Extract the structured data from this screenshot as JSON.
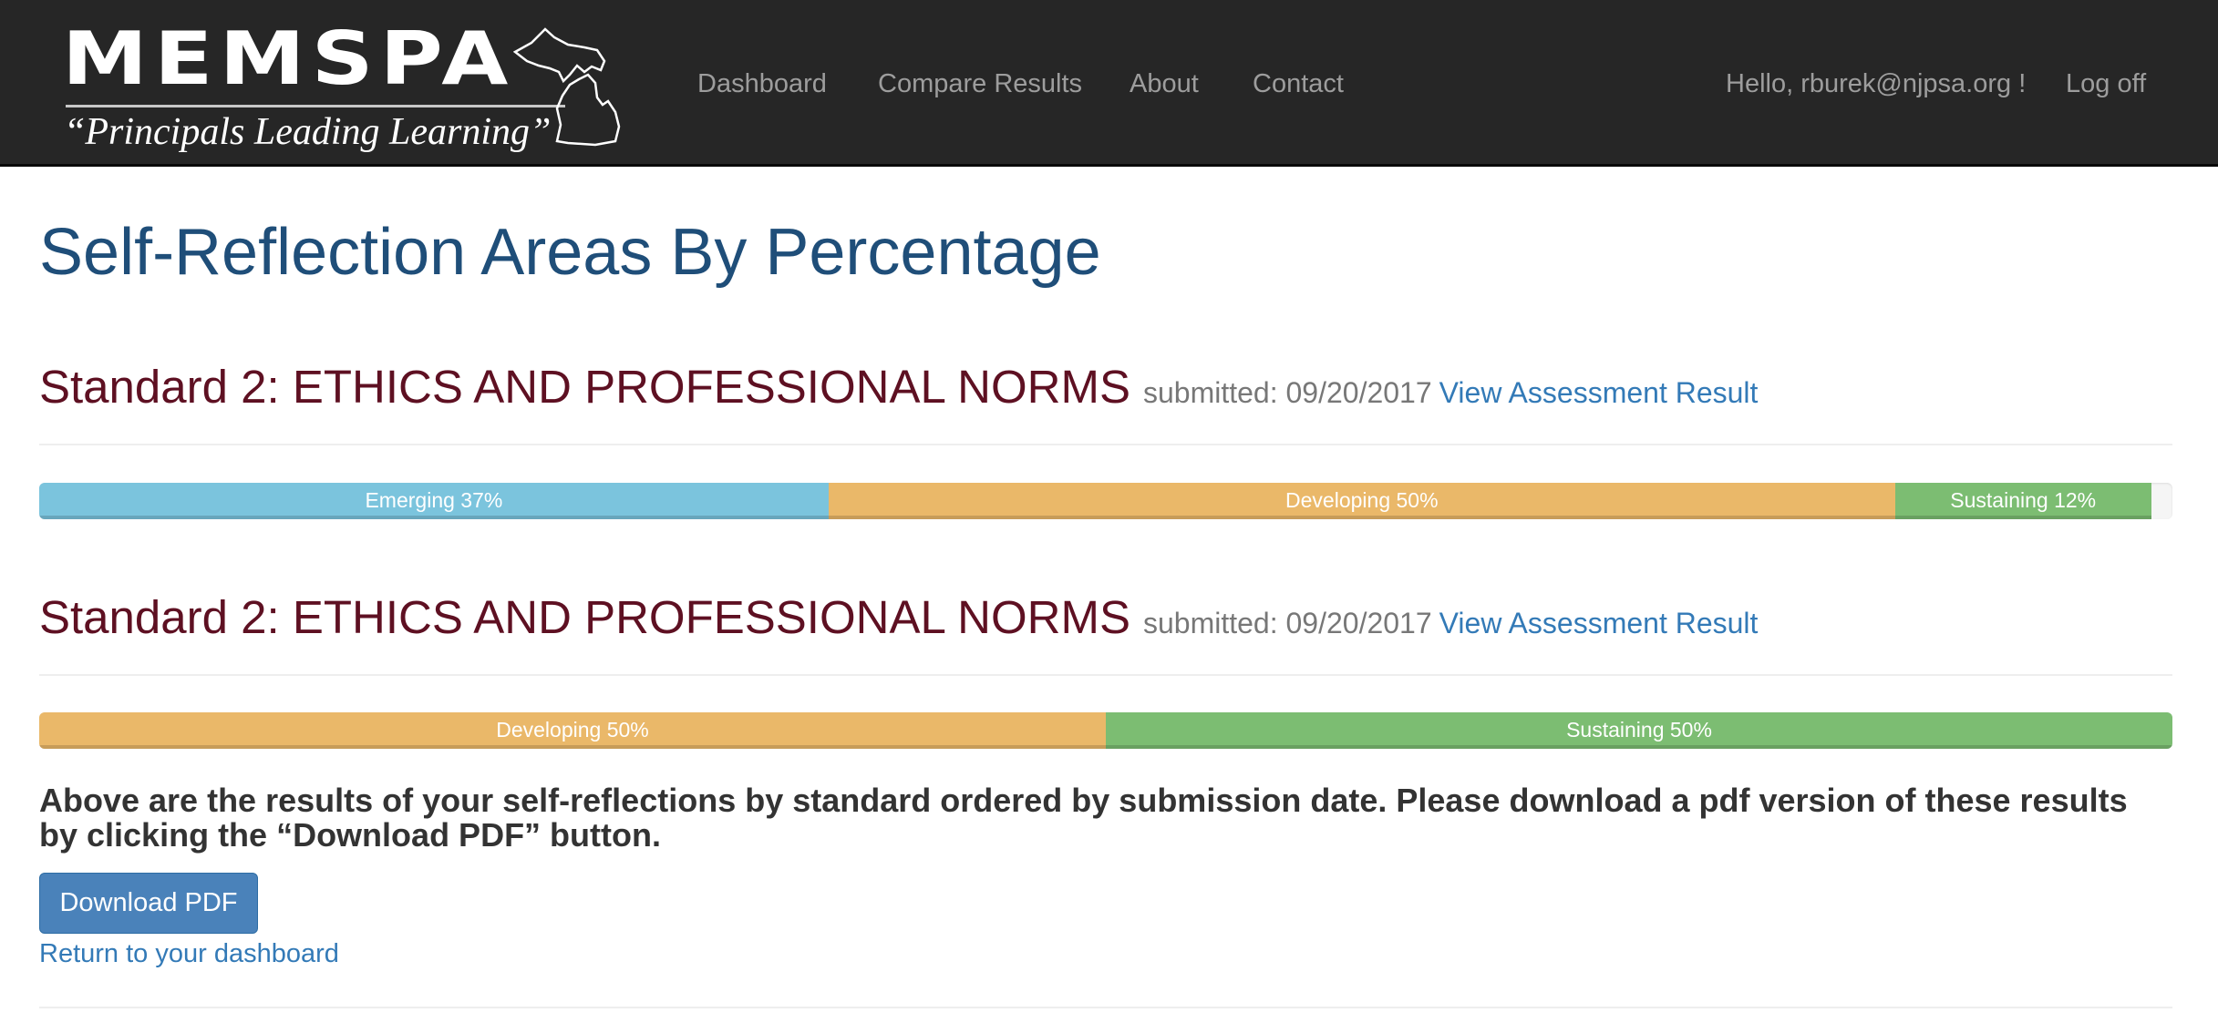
{
  "header": {
    "logo": {
      "wordmark": "MEMSPA",
      "tagline": "“Principals Leading Learning”",
      "icon": "michigan-map-icon"
    },
    "nav": [
      {
        "label": "Dashboard"
      },
      {
        "label": "Compare Results"
      },
      {
        "label": "About"
      },
      {
        "label": "Contact"
      }
    ],
    "greeting": "Hello, rburek@njpsa.org !",
    "logoff_label": "Log off"
  },
  "page": {
    "title": "Self-Reflection Areas By Percentage"
  },
  "colors": {
    "emerging": "#7bc4dd",
    "developing": "#eab869",
    "sustaining": "#7cbd72",
    "heading": "#5e1022",
    "title": "#1f4e79",
    "link": "#337ab7"
  },
  "standards": [
    {
      "title": "Standard 2: ETHICS AND PROFESSIONAL NORMS",
      "submitted": "submitted: 09/20/2017",
      "link_label": "View Assessment Result",
      "segments": [
        {
          "label": "Emerging 37%",
          "level": "emerging",
          "percent": 37
        },
        {
          "label": "Developing 50%",
          "level": "developing",
          "percent": 50
        },
        {
          "label": "Sustaining 12%",
          "level": "sustaining",
          "percent": 12
        }
      ]
    },
    {
      "title": "Standard 2: ETHICS AND PROFESSIONAL NORMS",
      "submitted": "submitted: 09/20/2017",
      "link_label": "View Assessment Result",
      "segments": [
        {
          "label": "Developing 50%",
          "level": "developing",
          "percent": 50
        },
        {
          "label": "Sustaining 50%",
          "level": "sustaining",
          "percent": 50
        }
      ]
    }
  ],
  "footer": {
    "description": "Above are the results of your self-reflections by standard ordered by submission date. Please download a pdf version of these results by clicking the “Download PDF” button.",
    "download_label": "Download PDF",
    "return_label": "Return to your dashboard"
  }
}
